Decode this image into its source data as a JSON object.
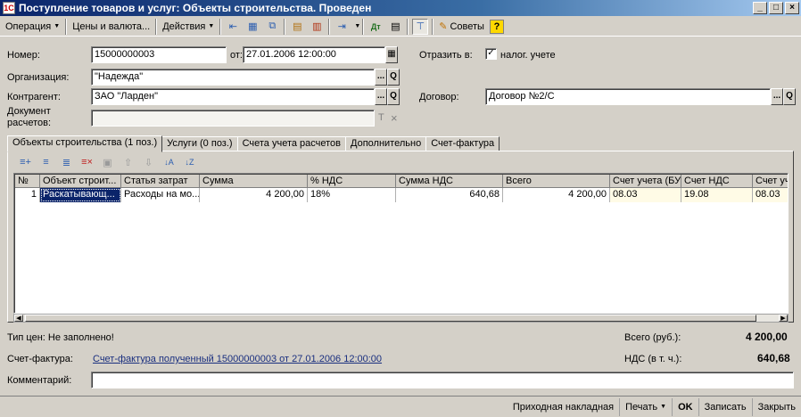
{
  "window": {
    "title": "Поступление товаров и услуг: Объекты строительства. Проведен",
    "minimize": "_",
    "maximize": "□",
    "close": "×"
  },
  "toolbar": {
    "operation": "Операция",
    "prices": "Цены и валюта...",
    "actions": "Действия",
    "advice": "Советы",
    "help": "?"
  },
  "form": {
    "number_label": "Номер:",
    "number_value": "15000000003",
    "date_label": "от:",
    "date_value": "27.01.2006 12:00:00",
    "reflect_label": "Отразить в:",
    "tax_accounting_label": "налог. учете",
    "tax_accounting_checked": "✓",
    "organization_label": "Организация:",
    "organization_value": "\"Надежда\"",
    "counterparty_label": "Контрагент:",
    "counterparty_value": "ЗАО \"Ларден\"",
    "contract_label": "Договор:",
    "contract_value": "Договор №2/С",
    "settlement_doc_label_1": "Документ",
    "settlement_doc_label_2": "расчетов:",
    "settlement_doc_value": "",
    "select_button": "...",
    "open_button": "Q",
    "clear_t": "T",
    "clear_x": "×"
  },
  "tabs": [
    {
      "label": "Объекты строительства (1 поз.)"
    },
    {
      "label": "Услуги (0 поз.)"
    },
    {
      "label": "Счета учета расчетов"
    },
    {
      "label": "Дополнительно"
    },
    {
      "label": "Счет-фактура"
    }
  ],
  "table": {
    "columns": [
      "№",
      "Объект строит...",
      "Статья затрат",
      "Сумма",
      "% НДС",
      "Сумма НДС",
      "Всего",
      "Счет учета (БУ)",
      "Счет НДС",
      "Счет уч"
    ],
    "rows": [
      [
        "1",
        "Раскатывающ...",
        "Расходы на мо...",
        "4 200,00",
        "18%",
        "640,68",
        "4 200,00",
        "08.03",
        "19.08",
        "08.03"
      ]
    ]
  },
  "footer": {
    "price_type": "Тип цен: Не заполнено!",
    "total_label": "Всего (руб.):",
    "total_value": "4 200,00",
    "invoice_label": "Счет-фактура:",
    "invoice_link": "Счет-фактура полученный 15000000003 от 27.01.2006 12:00:00",
    "vat_label": "НДС (в т. ч.):",
    "vat_value": "640,68",
    "comment_label": "Комментарий:",
    "comment_value": ""
  },
  "bottom_buttons": {
    "receipt": "Приходная накладная",
    "print": "Печать",
    "ok": "OK",
    "save": "Записать",
    "close": "Закрыть"
  }
}
